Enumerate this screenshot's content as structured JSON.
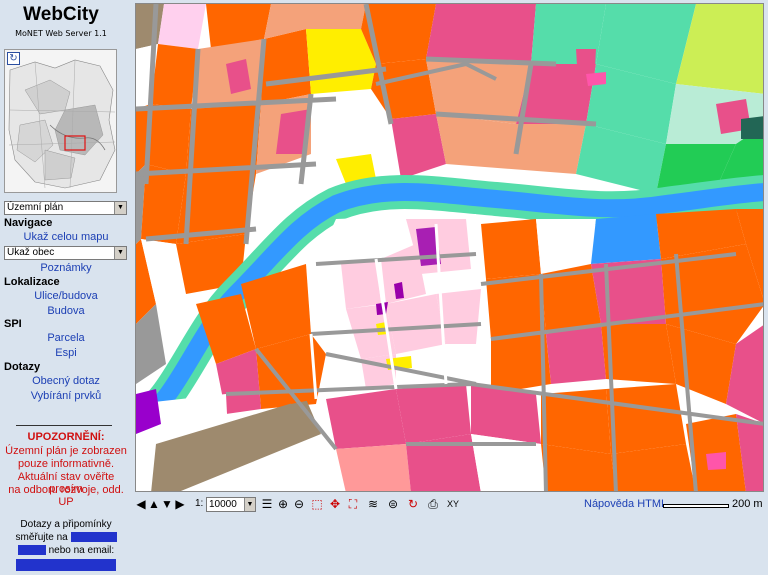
{
  "app": {
    "title": "WebCity",
    "subtitle": "MoNET Web Server 1.1"
  },
  "sidebar": {
    "layer_select": "Územní plán",
    "nav_heading": "Navigace",
    "show_full_map": "Ukaž celou mapu",
    "municipality_select": "Ukaž obec",
    "notes_link": "Poznámky",
    "localization_heading": "Lokalizace",
    "street_link": "Ulice/budova",
    "building_link": "Budova",
    "spi_heading": "SPI",
    "parcel_link": "Parcela",
    "espi_link": "Espi",
    "queries_heading": "Dotazy",
    "general_query_link": "Obecný dotaz",
    "select_features_link": "Vybírání prvků"
  },
  "warning": {
    "title": "UPOZORNĚNÍ:",
    "lines": [
      "Územní plán je zobrazen",
      "pouze informativně.",
      "Aktuální stav ověřte prosím",
      "na odboru rozvoje, odd. UP"
    ]
  },
  "contact": {
    "line1": "Dotazy a připomínky",
    "line2": "směřujte na",
    "line3": "nebo na email:"
  },
  "toolbar": {
    "scale_label": "1:",
    "scale_value": "10000",
    "xy_label": "XY",
    "help_link": "Nápověda HTML",
    "scale_text": "200 m"
  },
  "icons": {
    "reset": "refresh-icon",
    "pan": [
      "arrow-left-icon",
      "arrow-up-icon",
      "arrow-down-icon",
      "arrow-right-icon"
    ],
    "tools": [
      "legend-icon",
      "zoom-in-icon",
      "zoom-out-icon",
      "zoom-box-icon",
      "pan-move-icon",
      "full-extent-icon",
      "layers-icon",
      "info-icon",
      "refresh-map-icon",
      "print-icon"
    ]
  },
  "colors": {
    "sidebar_bg": "#d9e3ee",
    "link": "#1c3fb4",
    "warning": "#d01010",
    "river": "#3399ff",
    "residential": "#ff6600",
    "mixed": "#e8508a",
    "center": "#ffcce0",
    "green": "#55ddaa",
    "roads": "#999999"
  }
}
